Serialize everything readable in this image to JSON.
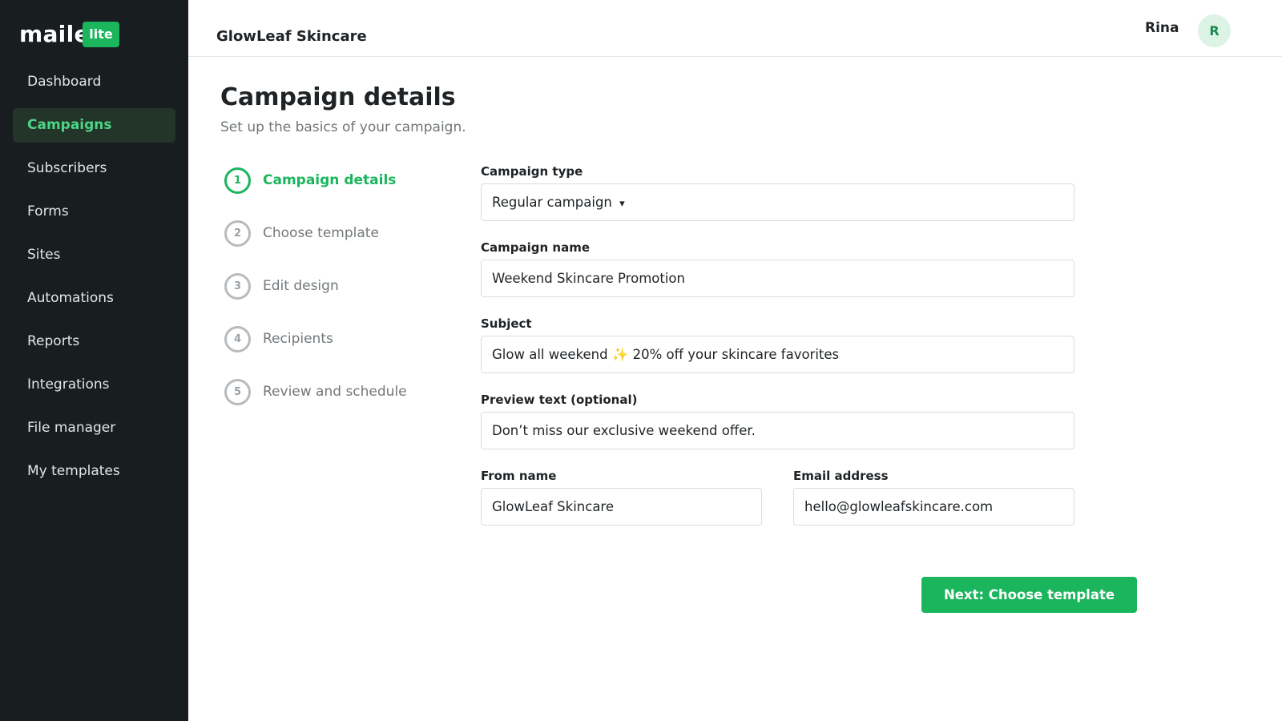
{
  "brand": {
    "logo_text": "maile",
    "logo_badge": "lite",
    "accent": "#1ab55c"
  },
  "sidebar": {
    "items": [
      {
        "label": "Dashboard",
        "active": false
      },
      {
        "label": "Campaigns",
        "active": true
      },
      {
        "label": "Subscribers",
        "active": false
      },
      {
        "label": "Forms",
        "active": false
      },
      {
        "label": "Sites",
        "active": false
      },
      {
        "label": "Automations",
        "active": false
      },
      {
        "label": "Reports",
        "active": false
      },
      {
        "label": "Integrations",
        "active": false
      },
      {
        "label": "File manager",
        "active": false
      },
      {
        "label": "My templates",
        "active": false
      }
    ]
  },
  "header": {
    "org_name": "GlowLeaf Skincare",
    "user_name": "Rina",
    "avatar_initial": "R"
  },
  "page": {
    "title": "Campaign details",
    "subtitle": "Set up the basics of your campaign."
  },
  "steps": [
    {
      "number": "1",
      "label": "Campaign details",
      "active": true
    },
    {
      "number": "2",
      "label": "Choose template",
      "active": false
    },
    {
      "number": "3",
      "label": "Edit design",
      "active": false
    },
    {
      "number": "4",
      "label": "Recipients",
      "active": false
    },
    {
      "number": "5",
      "label": "Review and schedule",
      "active": false
    }
  ],
  "form": {
    "campaign_type": {
      "label": "Campaign type",
      "value": "Regular campaign",
      "caret": "▾"
    },
    "campaign_name": {
      "label": "Campaign name",
      "value": "Weekend Skincare Promotion"
    },
    "subject": {
      "label": "Subject",
      "value": "Glow all weekend ✨ 20% off your skincare favorites"
    },
    "preview_text": {
      "label": "Preview text (optional)",
      "value": "Don’t miss our exclusive weekend offer."
    },
    "from_name": {
      "label": "From name",
      "value": "GlowLeaf Skincare"
    },
    "email_address": {
      "label": "Email address",
      "value": "hello@glowleafskincare.com"
    }
  },
  "actions": {
    "next_label": "Next: Choose template"
  }
}
